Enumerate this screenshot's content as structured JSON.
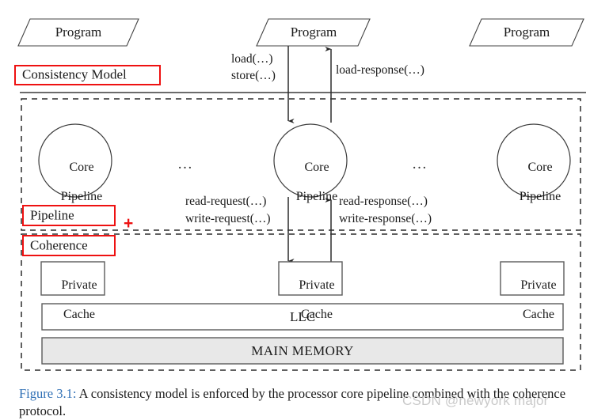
{
  "figure": {
    "caption_number": "Figure 3.1:",
    "caption_text": " A consistency model is enforced by the processor core pipeline combined with the coherence protocol.",
    "accent_color": "#2f6fb5",
    "annotation_color": "#ee1111"
  },
  "watermark": {
    "text": "CSDN @newyork major"
  },
  "programs": [
    {
      "label": "Program"
    },
    {
      "label": "Program"
    },
    {
      "label": "Program"
    }
  ],
  "annotations": {
    "consistency_model": "Consistency Model",
    "pipeline": "Pipeline",
    "plus": "+",
    "coherence": "Coherence"
  },
  "messages": {
    "load": "load(…)",
    "store": "store(…)",
    "load_response": "load-response(…)",
    "read_request": "read-request(…)",
    "write_request": "write-request(…)",
    "read_response": "read-response(…)",
    "write_response": "write-response(…)"
  },
  "cores": [
    {
      "line1": "Core",
      "line2": "Pipeline"
    },
    {
      "line1": "Core",
      "line2": "Pipeline"
    },
    {
      "line1": "Core",
      "line2": "Pipeline"
    }
  ],
  "ellipses": {
    "left": "…",
    "right": "…"
  },
  "caches": [
    {
      "line1": "Private",
      "line2": "Cache"
    },
    {
      "line1": "Private",
      "line2": "Cache"
    },
    {
      "line1": "Private",
      "line2": "Cache"
    }
  ],
  "llc": {
    "label": "LLC"
  },
  "main_memory": {
    "label": "MAIN MEMORY"
  }
}
